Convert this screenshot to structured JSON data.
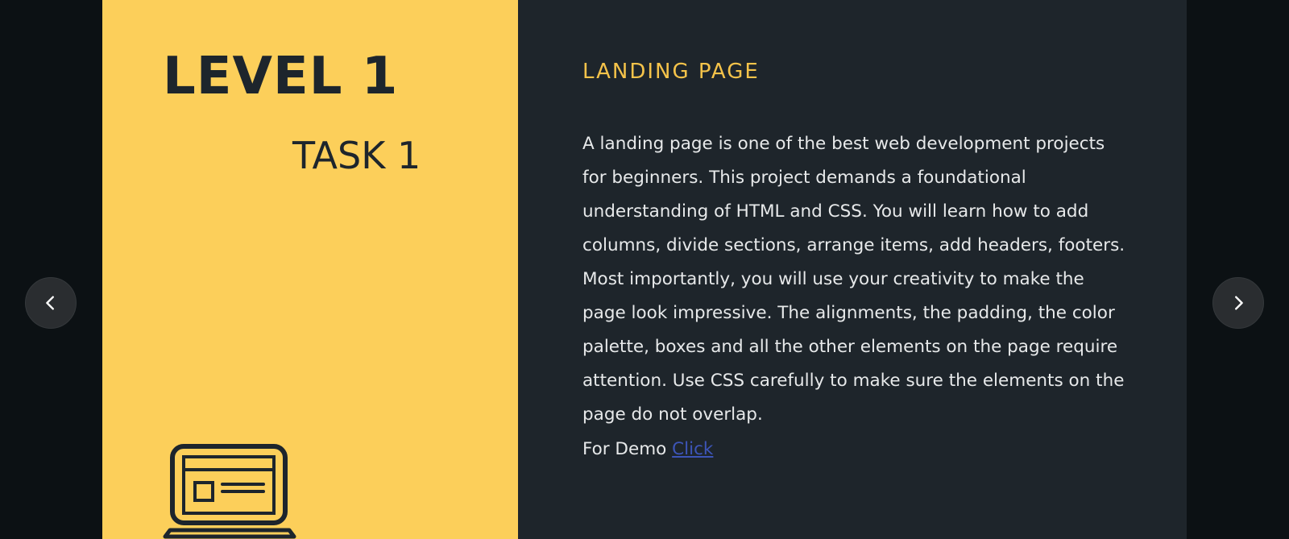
{
  "slide": {
    "level": "LEVEL 1",
    "task": "TASK 1",
    "icon": "laptop-icon",
    "section_title": "LANDING PAGE",
    "description": "A landing page is one of the best web development projects for beginners. This project demands a foundational understanding of HTML and CSS. You will learn how to add columns, divide sections, arrange items, add headers, footers. Most importantly, you will use your creativity to make the page look impressive. The alignments, the padding, the color palette, boxes and all the other elements on the page require attention. Use CSS carefully to make sure the elements on the page do not overlap.",
    "demo_label": "For Demo",
    "demo_link_text": "Click "
  },
  "navigation": {
    "prev_icon": "chevron-left-icon",
    "next_icon": "chevron-right-icon"
  },
  "colors": {
    "accent_yellow": "#fccf5a",
    "panel_dark": "#1e252b",
    "title_yellow": "#f5c34a",
    "link_blue": "#3d55b8",
    "background": "#0c1114"
  }
}
